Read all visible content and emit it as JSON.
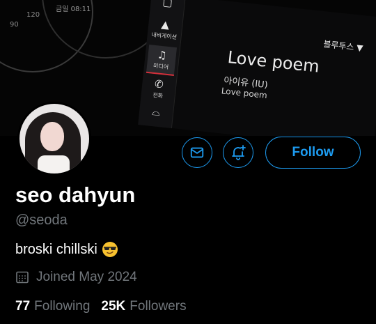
{
  "banner": {
    "cluster_numbers": [
      "120",
      "90"
    ],
    "cluster_text": "금일 08:11",
    "sidebar": [
      {
        "label": "내비게이션",
        "icon": "navigation-arrow-icon"
      },
      {
        "label": "미디어",
        "icon": "music-note-icon"
      },
      {
        "label": "전화",
        "icon": "phone-icon"
      }
    ],
    "bluetooth_label": "블루투스 ▼",
    "song_title": "Love poem",
    "artist": "아이유 (IU)",
    "album": "Love poem"
  },
  "profile": {
    "display_name": "seo dahyun",
    "handle": "@seoda",
    "bio_text": "broski chillski",
    "bio_emoji": "sunglasses-emoji",
    "joined": "Joined May 2024",
    "following_count": "77",
    "following_label": "Following",
    "followers_count": "25K",
    "followers_label": "Followers"
  },
  "actions": {
    "follow_label": "Follow",
    "message_icon": "envelope-icon",
    "notify_icon": "bell-plus-icon"
  },
  "colors": {
    "accent": "#1d9bf0",
    "muted_text": "#71767b",
    "background": "#000000"
  }
}
